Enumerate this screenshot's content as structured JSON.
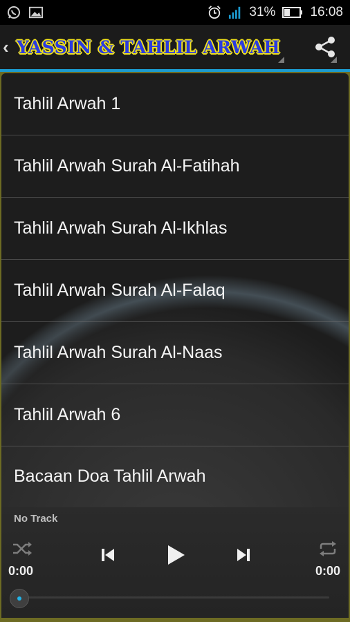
{
  "status_bar": {
    "battery_text": "31%",
    "time": "16:08",
    "icons": [
      "whatsapp-icon",
      "gallery-icon",
      "alarm-icon",
      "signal-icon",
      "battery-icon"
    ]
  },
  "action_bar": {
    "title": "YASSIN & TAHLIL ARWAH",
    "icons": [
      "back-chevron-icon",
      "share-icon"
    ]
  },
  "tracks": [
    "Tahlil Arwah 1",
    "Tahlil Arwah Surah Al-Fatihah",
    "Tahlil Arwah Surah Al-Ikhlas",
    "Tahlil Arwah Surah Al-Falaq",
    "Tahlil Arwah Surah Al-Naas",
    "Tahlil Arwah 6",
    "Bacaan Doa Tahlil Arwah"
  ],
  "player": {
    "track_name": "No Track",
    "elapsed": "0:00",
    "duration": "0:00",
    "progress": 0,
    "icons": [
      "shuffle-icon",
      "previous-icon",
      "play-icon",
      "next-icon",
      "repeat-icon"
    ]
  },
  "colors": {
    "title_fill": "#2a3be0",
    "title_outline": "#f2e31f",
    "accent": "#1c9bd0",
    "frame": "#6d6b23"
  }
}
